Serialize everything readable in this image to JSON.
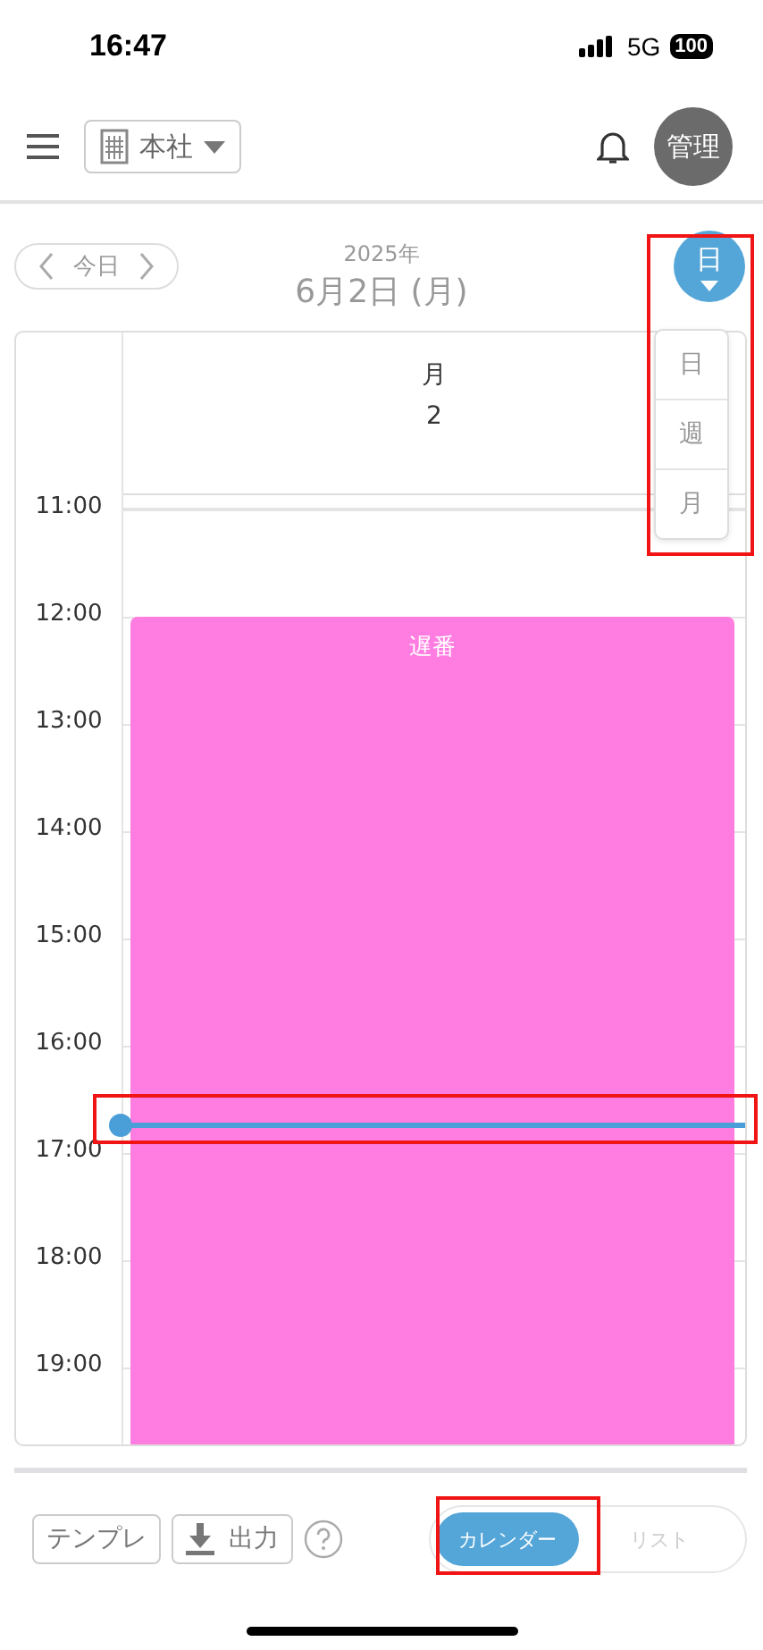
{
  "status_bar": {
    "time": "16:47",
    "network": "5G",
    "battery": "100"
  },
  "header": {
    "location": "本社",
    "avatar": "管理"
  },
  "date_nav": {
    "today": "今日",
    "year": "2025年",
    "date": "6月2日 (月)"
  },
  "view_switch": {
    "label": "日",
    "expanded": true,
    "options": [
      "日",
      "週",
      "月"
    ]
  },
  "calendar": {
    "day_name": "月",
    "day_number": "2",
    "hours": [
      "11:00",
      "12:00",
      "13:00",
      "14:00",
      "15:00",
      "16:00",
      "17:00",
      "18:00",
      "19:00"
    ],
    "events": [
      {
        "title": "遅番",
        "color": "#ff7de0"
      }
    ],
    "now_line": true
  },
  "footer": {
    "buttons": [
      {
        "label": "テンプレ",
        "kind": "text"
      },
      {
        "label": "出力",
        "kind": "download"
      }
    ],
    "views": [
      {
        "label": "カレンダー",
        "selected": true
      },
      {
        "label": "リスト",
        "selected": false
      }
    ]
  }
}
